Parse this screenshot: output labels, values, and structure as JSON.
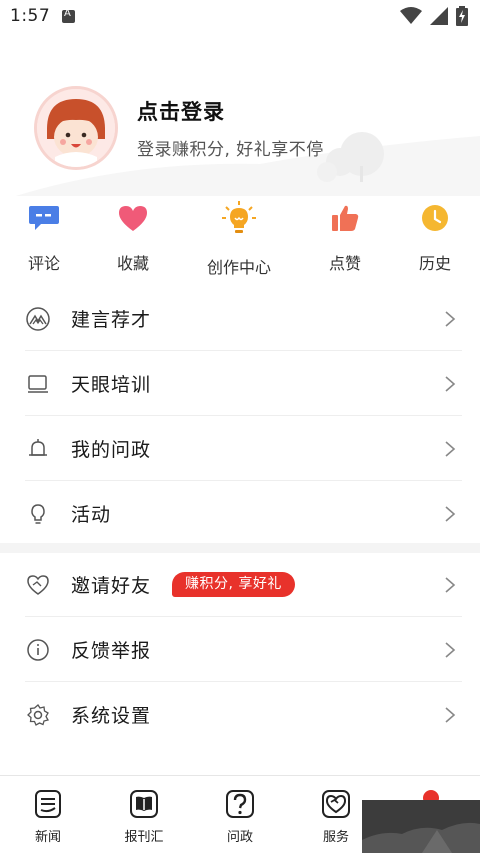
{
  "status_bar": {
    "time": "1:57",
    "notification_icon": "text-a-icon",
    "icons": [
      "wifi-icon",
      "signal-icon",
      "battery-charging-icon"
    ]
  },
  "profile": {
    "avatar_icon": "cartoon-avatar-icon",
    "title": "点击登录",
    "subtitle": "登录赚积分, 好礼享不停"
  },
  "quick_actions": [
    {
      "label": "评论",
      "icon": "comment-icon",
      "color": "#4a7ee6"
    },
    {
      "label": "收藏",
      "icon": "heart-icon",
      "color": "#f05a78"
    },
    {
      "label": "创作中心",
      "icon": "lightbulb-icon",
      "color": "#f5a623"
    },
    {
      "label": "点赞",
      "icon": "thumbs-up-icon",
      "color": "#f07156"
    },
    {
      "label": "历史",
      "icon": "clock-icon",
      "color": "#f5b731"
    }
  ],
  "menu_group_1": [
    {
      "label": "建言荐才",
      "icon": "mountain-icon"
    },
    {
      "label": "天眼培训",
      "icon": "laptop-icon"
    },
    {
      "label": "我的问政",
      "icon": "bell-icon"
    },
    {
      "label": "活动",
      "icon": "lightbulb-outline-icon"
    }
  ],
  "menu_group_2": [
    {
      "label": "邀请好友",
      "icon": "heart-handshake-icon",
      "badge": "赚积分, 享好礼"
    },
    {
      "label": "反馈举报",
      "icon": "info-icon"
    },
    {
      "label": "系统设置",
      "icon": "settings-icon"
    }
  ],
  "bottom_nav": [
    {
      "label": "新闻",
      "icon": "news-icon"
    },
    {
      "label": "报刊汇",
      "icon": "book-icon"
    },
    {
      "label": "问政",
      "icon": "question-icon"
    },
    {
      "label": "服务",
      "icon": "service-heart-icon"
    },
    {
      "label": "",
      "icon": "profile-icon"
    }
  ],
  "colors": {
    "accent_red": "#e8322b",
    "text_primary": "#1a1a1a",
    "text_secondary": "#555555",
    "divider": "#eeeeee"
  }
}
